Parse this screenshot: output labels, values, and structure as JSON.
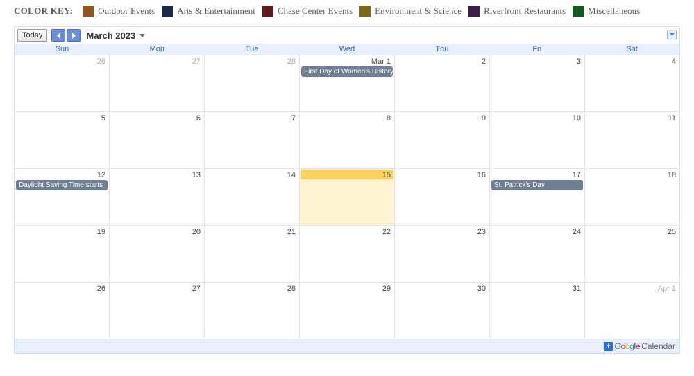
{
  "colorKey": {
    "label": "COLOR KEY:",
    "items": [
      {
        "label": "Outdoor Events",
        "color": "#8a5a1e"
      },
      {
        "label": "Arts & Entertainment",
        "color": "#1b2a4a"
      },
      {
        "label": "Chase Center Events",
        "color": "#5d1b1f"
      },
      {
        "label": "Environment & Science",
        "color": "#7a6a1a"
      },
      {
        "label": "Riverfront Restaurants",
        "color": "#3a1e4a"
      },
      {
        "label": "Miscellaneous",
        "color": "#0f5a1c"
      }
    ]
  },
  "toolbar": {
    "today": "Today",
    "month": "March 2023"
  },
  "dayHeaders": [
    "Sun",
    "Mon",
    "Tue",
    "Wed",
    "Thu",
    "Fri",
    "Sat"
  ],
  "weeks": [
    [
      {
        "label": "26",
        "other": true
      },
      {
        "label": "27",
        "other": true
      },
      {
        "label": "28",
        "other": true
      },
      {
        "label": "Mar 1",
        "events": [
          {
            "title": "First Day of Women's History Month"
          }
        ]
      },
      {
        "label": "2"
      },
      {
        "label": "3"
      },
      {
        "label": "4"
      }
    ],
    [
      {
        "label": "5"
      },
      {
        "label": "6"
      },
      {
        "label": "7"
      },
      {
        "label": "8"
      },
      {
        "label": "9"
      },
      {
        "label": "10"
      },
      {
        "label": "11"
      }
    ],
    [
      {
        "label": "12",
        "events": [
          {
            "title": "Daylight Saving Time starts"
          }
        ]
      },
      {
        "label": "13"
      },
      {
        "label": "14"
      },
      {
        "label": "15",
        "today": true
      },
      {
        "label": "16"
      },
      {
        "label": "17",
        "events": [
          {
            "title": "St. Patrick's Day"
          }
        ]
      },
      {
        "label": "18"
      }
    ],
    [
      {
        "label": "19"
      },
      {
        "label": "20"
      },
      {
        "label": "21"
      },
      {
        "label": "22"
      },
      {
        "label": "23"
      },
      {
        "label": "24"
      },
      {
        "label": "25"
      }
    ],
    [
      {
        "label": "26"
      },
      {
        "label": "27"
      },
      {
        "label": "28"
      },
      {
        "label": "29"
      },
      {
        "label": "30"
      },
      {
        "label": "31"
      },
      {
        "label": "Apr 1",
        "other": true
      }
    ]
  ],
  "footer": {
    "google": "Google",
    "calendar": "Calendar"
  }
}
